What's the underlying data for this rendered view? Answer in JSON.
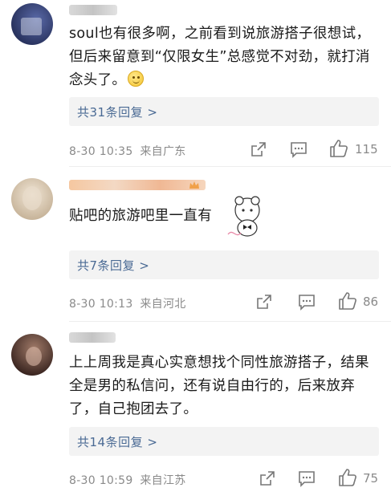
{
  "comments": [
    {
      "text": "soul也有很多啊，之前看到说旅游搭子很想试，但后来留意到“仅限女生”总感觉不对劲，就打消念头了。",
      "reply_link": "共31条回复 >",
      "date_time": "8-30 10:35",
      "location": "来自广东",
      "likes": "115"
    },
    {
      "text": "贴吧的旅游吧里一直有",
      "reply_link": "共7条回复 >",
      "date_time": "8-30 10:13",
      "location": "来自河北",
      "likes": "86"
    },
    {
      "text": "上上周我是真心实意想找个同性旅游搭子，结果全是男的私信问，还有说自由行的，后来放弃了，自己抱团去了。",
      "reply_link": "共14条回复 >",
      "date_time": "8-30 10:59",
      "location": "来自江苏",
      "likes": "75"
    }
  ],
  "icons": {
    "share": "share-icon",
    "comment": "comment-icon",
    "like": "thumbs-up-icon",
    "emoji": "smile-emoji-icon"
  },
  "colors": {
    "link": "#4a6a94",
    "meta": "#8a8a8a",
    "reply_bg": "#f3f3f3"
  }
}
